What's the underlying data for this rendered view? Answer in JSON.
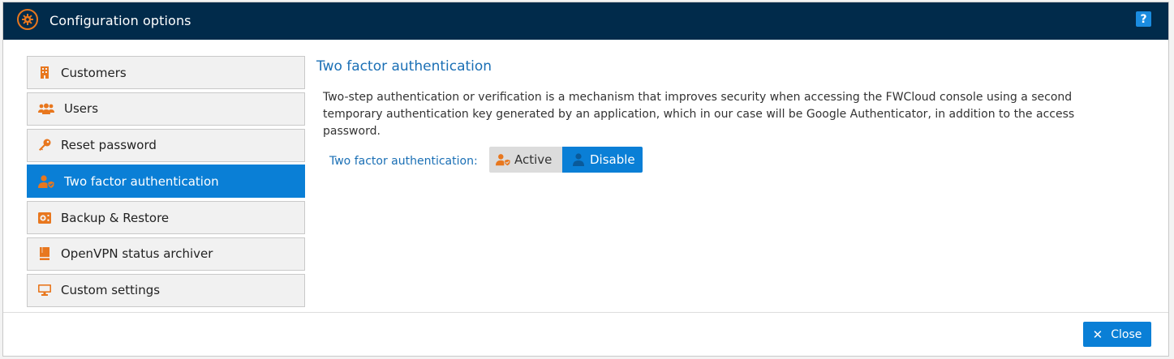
{
  "window": {
    "title": "Configuration options",
    "help_label": "?"
  },
  "menu": {
    "items": [
      {
        "label": "Customers",
        "icon": "building-icon",
        "active": false
      },
      {
        "label": "Users",
        "icon": "users-icon",
        "active": false
      },
      {
        "label": "Reset password",
        "icon": "key-icon",
        "active": false
      },
      {
        "label": "Two factor authentication",
        "icon": "user-shield-icon",
        "active": true
      },
      {
        "label": "Backup & Restore",
        "icon": "backup-icon",
        "active": false
      },
      {
        "label": "OpenVPN status archiver",
        "icon": "archive-icon",
        "active": false
      },
      {
        "label": "Custom settings",
        "icon": "monitor-icon",
        "active": false
      }
    ]
  },
  "content": {
    "title": "Two factor authentication",
    "description": "Two-step authentication or verification is a mechanism that improves security when accessing the FWCloud console using a second temporary authentication key generated by an application, which in our case will be Google Authenticator, in addition to the access password.",
    "field_label": "Two factor authentication:",
    "toggle": {
      "options": [
        "Active",
        "Disable"
      ],
      "selected": "Disable"
    }
  },
  "footer": {
    "close_label": "Close"
  },
  "colors": {
    "titlebar": "#012b4b",
    "accent": "#0a7fd6",
    "icon_orange": "#e8771e",
    "heading_blue": "#1a6fb5"
  }
}
